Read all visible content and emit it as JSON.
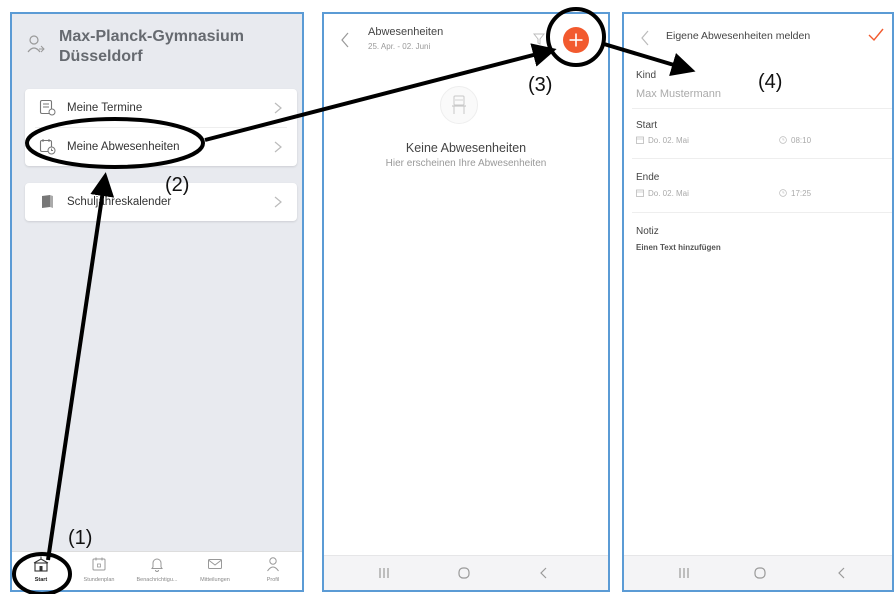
{
  "panel1": {
    "school_name": "Max-Planck-Gymnasium Düsseldorf",
    "menu_group1": [
      {
        "label": "Meine Termine",
        "icon": "calendar-list-icon"
      },
      {
        "label": "Meine Abwesenheiten",
        "icon": "calendar-clock-icon"
      }
    ],
    "menu_group2": [
      {
        "label": "Schuljahreskalender",
        "icon": "book-icon"
      }
    ],
    "tabs": [
      {
        "label": "Start",
        "icon": "school-icon",
        "active": true
      },
      {
        "label": "Stundenplan",
        "icon": "timetable-icon"
      },
      {
        "label": "Benachrichtigu...",
        "icon": "bell-icon"
      },
      {
        "label": "Mitteilungen",
        "icon": "mail-icon"
      },
      {
        "label": "Profil",
        "icon": "person-icon"
      }
    ]
  },
  "panel2": {
    "title": "Abwesenheiten",
    "date_range": "25. Apr. - 02. Juni",
    "empty_title": "Keine Abwesenheiten",
    "empty_subtitle": "Hier erscheinen Ihre Abwesenheiten",
    "accent_color": "#f25a2e"
  },
  "panel3": {
    "title": "Eigene Abwesenheiten melden",
    "kind_label": "Kind",
    "kind_value": "Max Mustermann",
    "start_label": "Start",
    "start_date": "Do. 02. Mai",
    "start_time": "08:10",
    "end_label": "Ende",
    "end_date": "Do. 02. Mai",
    "end_time": "17:25",
    "note_label": "Notiz",
    "note_placeholder": "Einen Text hinzufügen"
  },
  "annotations": {
    "step1": "(1)",
    "step2": "(2)",
    "step3": "(3)",
    "step4": "(4)"
  }
}
